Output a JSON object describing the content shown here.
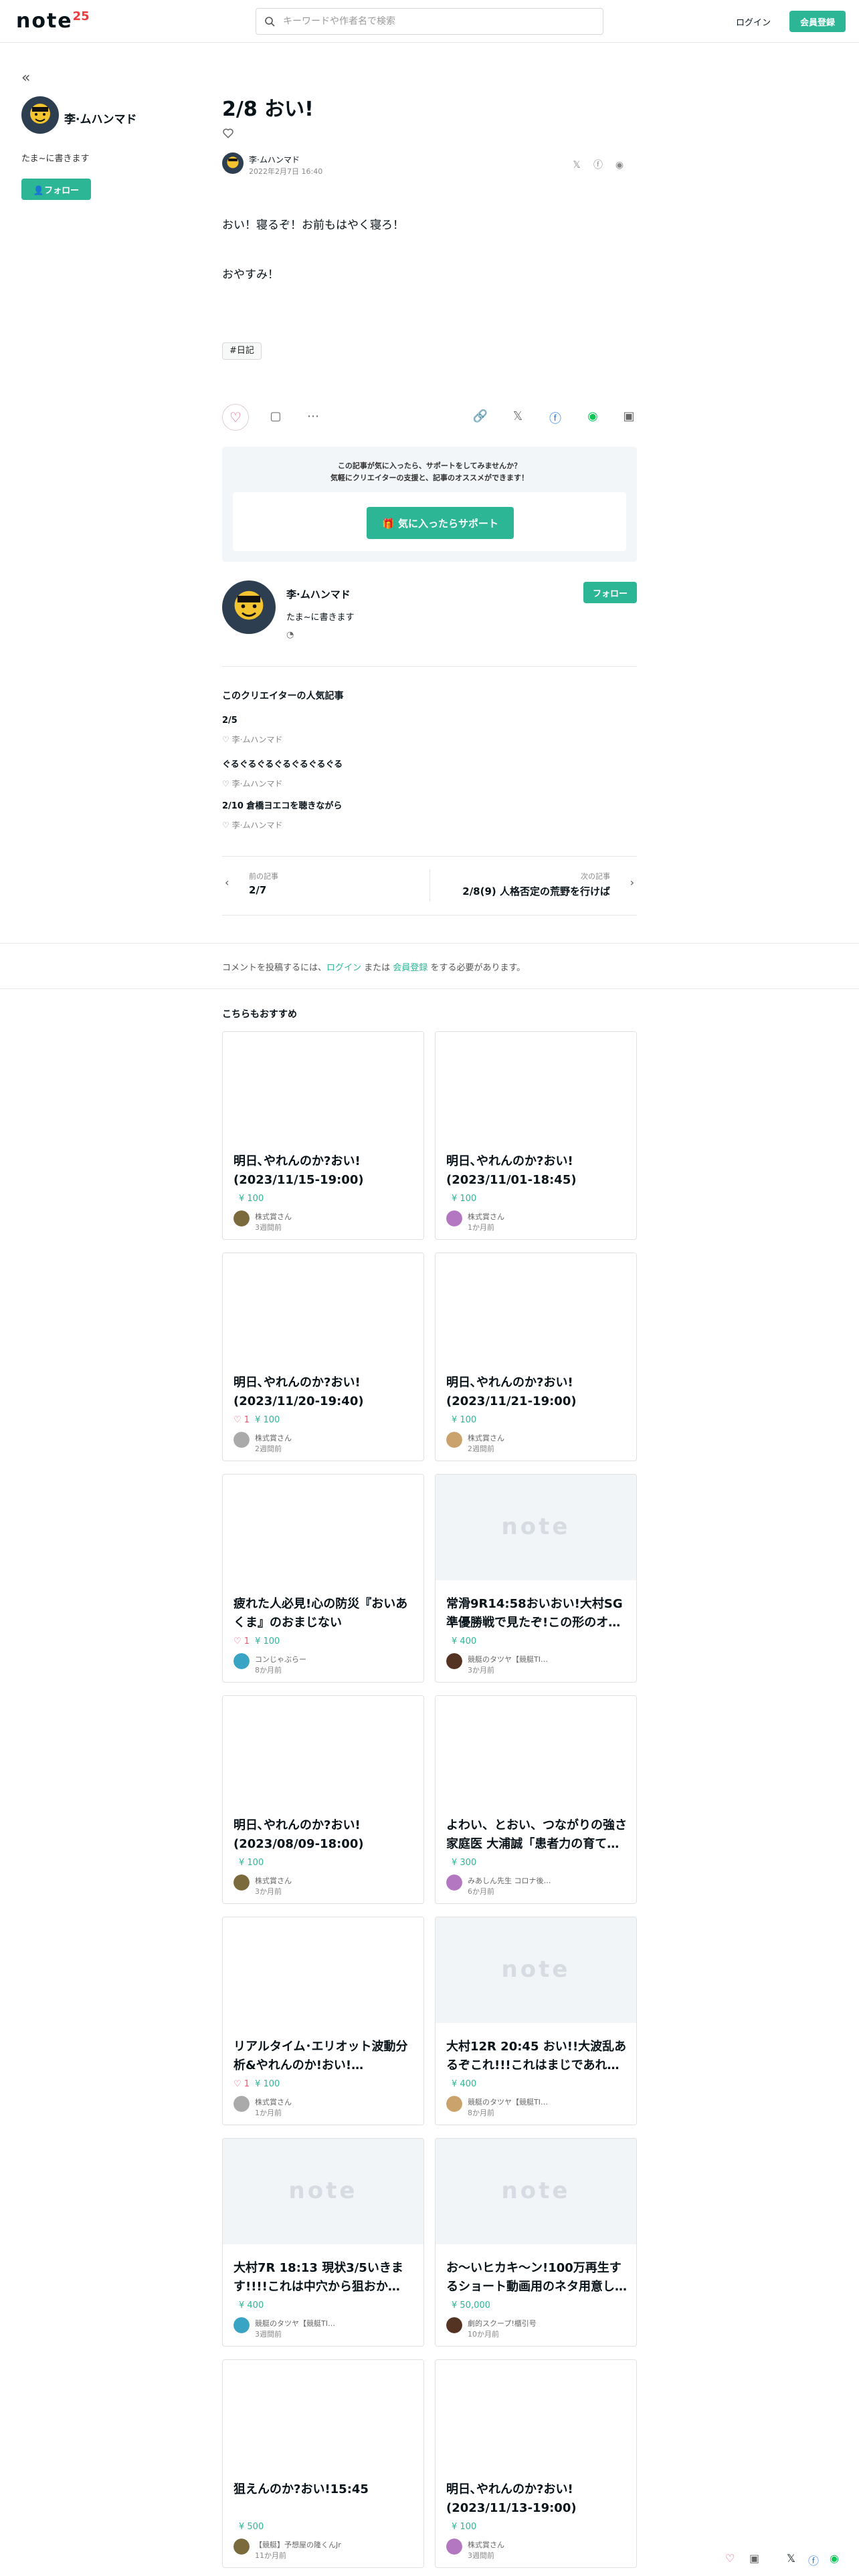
{
  "header": {
    "logo": "note",
    "logo_badge": "25",
    "search_placeholder": "キーワードや作者名で検索",
    "login": "ログイン",
    "signup": "会員登録"
  },
  "sidebar": {
    "collapse": "«",
    "name": "李·ムハンマド",
    "bio": "たま~に書きます",
    "follow": "フォロー"
  },
  "article": {
    "title": "2/8 おい!",
    "author": "李·ムハンマド",
    "date": "2022年2月7日 16:40",
    "body": [
      "おい！寝るぞ！お前もはやく寝ろ！",
      "おやすみ！"
    ],
    "tag": "#日記"
  },
  "support": {
    "line1": "この記事が気に入ったら、サポートをしてみませんか？",
    "line2": "気軽にクリエイターの支援と、記事のオススメができます！",
    "button": "気に入ったらサポート"
  },
  "creator": {
    "name": "李·ムハンマド",
    "bio": "たま~に書きます",
    "follow": "フォロー"
  },
  "popular": {
    "title": "このクリエイターの人気記事",
    "items": [
      {
        "title": "2/5",
        "author": "李·ムハンマド"
      },
      {
        "title": "ぐるぐるぐるぐるぐるぐるぐる",
        "author": "李·ムハンマド"
      },
      {
        "title": "2/10 倉橋ヨエコを聴きながら",
        "author": "李·ムハンマド"
      }
    ]
  },
  "nav": {
    "prev_label": "前の記事",
    "prev_title": "2/7",
    "next_label": "次の記事",
    "next_title": "2/8(9) 人格否定の荒野を行けば"
  },
  "comment": {
    "pre": "コメントを投稿するには、",
    "login": "ログイン",
    "mid": " または ",
    "signup": "会員登録",
    "post": " をする必要があります。"
  },
  "recommend": {
    "title": "こちらもおすすめ",
    "cards": [
      {
        "title": "明日､やれんのか?おい!(2023/11/15-19:00)",
        "likes": "",
        "price": "¥ 100",
        "author": "株式賞さん",
        "date": "3週間前",
        "ph": false
      },
      {
        "title": "明日､やれんのか?おい!(2023/11/01-18:45)",
        "likes": "",
        "price": "¥ 100",
        "author": "株式賞さん",
        "date": "1か月前",
        "ph": false
      },
      {
        "title": "明日､やれんのか?おい!(2023/11/20-19:40)",
        "likes": "♡ 1",
        "price": "¥ 100",
        "author": "株式賞さん",
        "date": "2週間前",
        "ph": false
      },
      {
        "title": "明日､やれんのか?おい!(2023/11/21-19:00)",
        "likes": "",
        "price": "¥ 100",
        "author": "株式賞さん",
        "date": "2週間前",
        "ph": false
      },
      {
        "title": "疲れた人必見!心の防災『おいあくま』のおまじない",
        "likes": "♡ 1",
        "price": "¥ 100",
        "author": "コンじゃぶらー",
        "date": "8か月前",
        "ph": false
      },
      {
        "title": "常滑9R14:58おいおい!大村SG準優勝戦で見たぞ!この形のオ…",
        "likes": "",
        "price": "¥ 400",
        "author": "競艇のタツヤ【競艇TI…",
        "date": "3か月前",
        "ph": true
      },
      {
        "title": "明日､やれんのか?おい!(2023/08/09-18:00)",
        "likes": "",
        "price": "¥ 100",
        "author": "株式賞さん",
        "date": "3か月前",
        "ph": false
      },
      {
        "title": "よわい、とおい、つながりの強さ 家庭医 大浦誠「患者力の育て…",
        "likes": "",
        "price": "¥ 300",
        "author": "みあしん先生 コロナ後…",
        "date": "6か月前",
        "ph": false
      },
      {
        "title": "リアルタイム･エリオット波動分析&やれんのか!おい!…",
        "likes": "♡ 1",
        "price": "¥ 100",
        "author": "株式賞さん",
        "date": "1か月前",
        "ph": false
      },
      {
        "title": "大村12R 20:45 おい!!大波乱あるぞこれ!!!これはまじであれ…",
        "likes": "",
        "price": "¥ 400",
        "author": "競艇のタツヤ【競艇TI…",
        "date": "8か月前",
        "ph": true
      },
      {
        "title": "大村7R 18:13 現状3/5いきます!!!!これは中穴から狙おか…",
        "likes": "",
        "price": "¥ 400",
        "author": "競艇のタツヤ【競艇TI…",
        "date": "3週間前",
        "ph": true
      },
      {
        "title": "お〜いヒカキ〜ン!100万再生するショート動画用のネタ用意し…",
        "likes": "",
        "price": "¥ 50,000",
        "author": "劇的スクープ!櫃引号",
        "date": "10か月前",
        "ph": true
      },
      {
        "title": "狙えんのか?おい!15:45",
        "likes": "",
        "price": "¥ 500",
        "author": "【競艇】予想屋の隆くんJr",
        "date": "11か月前",
        "ph": false
      },
      {
        "title": "明日､やれんのか?おい!(2023/11/13-19:00)",
        "likes": "",
        "price": "¥ 100",
        "author": "株式賞さん",
        "date": "3週間前",
        "ph": false
      }
    ]
  },
  "colors": {
    "accent": "#2cb696",
    "like": "#e95572",
    "border": "#e6e6e6"
  },
  "icons": [
    "search-icon",
    "heart-icon",
    "comment-icon",
    "more-icon",
    "link-icon",
    "x-icon",
    "facebook-icon",
    "line-icon",
    "gift-icon",
    "rss-icon"
  ]
}
